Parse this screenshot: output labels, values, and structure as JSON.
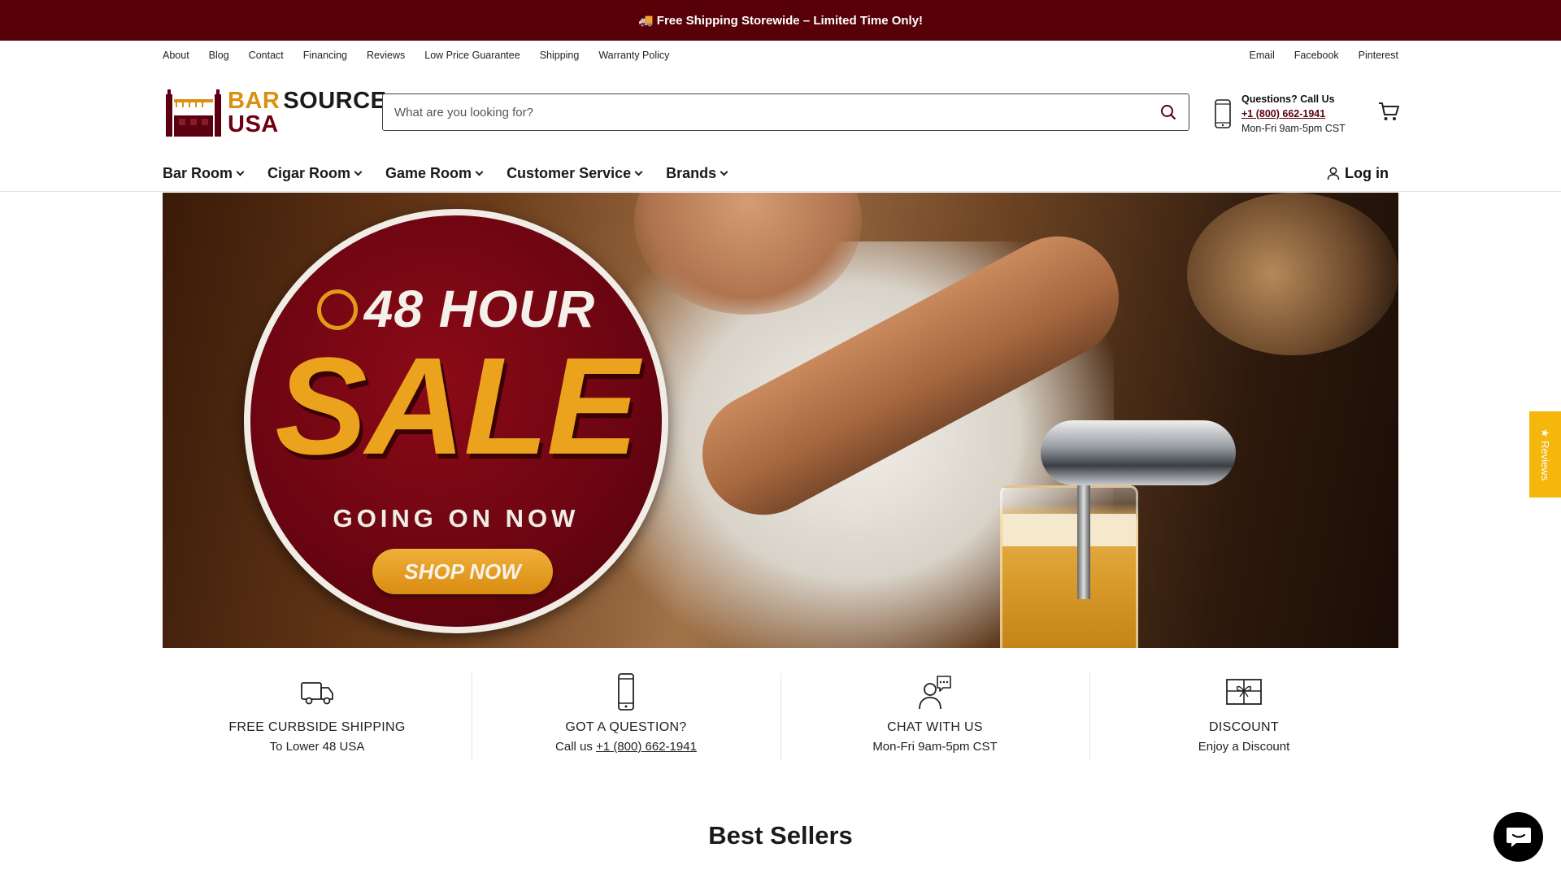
{
  "announcement": "🚚 Free Shipping Storewide – Limited Time Only!",
  "utility_nav": {
    "left": [
      "About",
      "Blog",
      "Contact",
      "Financing",
      "Reviews",
      "Low Price Guarantee",
      "Shipping",
      "Warranty Policy"
    ],
    "right": [
      "Email",
      "Facebook",
      "Pinterest"
    ]
  },
  "logo": {
    "line1_a": "BAR",
    "line1_b": "SOURCE",
    "line2": "USA"
  },
  "search": {
    "placeholder": "What are you looking for?"
  },
  "contact": {
    "title": "Questions? Call Us",
    "phone": "+1 (800) 662-1941",
    "hours": "Mon-Fri 9am-5pm CST"
  },
  "main_nav": [
    "Bar Room",
    "Cigar Room",
    "Game Room",
    "Customer Service",
    "Brands"
  ],
  "login_label": "Log in",
  "hero": {
    "line1": "48 HOUR",
    "line2": "SALE",
    "line3": "GOING ON NOW",
    "cta": "SHOP NOW"
  },
  "features": [
    {
      "icon": "truck-icon",
      "title": "FREE CURBSIDE SHIPPING",
      "sub": "To Lower 48 USA"
    },
    {
      "icon": "phone-icon",
      "title": "GOT A QUESTION?",
      "sub_prefix": "Call us ",
      "sub_link": "+1 (800) 662-1941"
    },
    {
      "icon": "chat-person-icon",
      "title": "CHAT WITH US",
      "sub": "Mon-Fri 9am-5pm CST"
    },
    {
      "icon": "gift-icon",
      "title": "DISCOUNT",
      "sub": "Enjoy a Discount"
    }
  ],
  "section_title": "Best Sellers",
  "reviews_tab": "★ Reviews",
  "colors": {
    "brand_dark": "#570008",
    "brand_gold": "#d8920f",
    "reviews_yellow": "#f5b70c"
  }
}
